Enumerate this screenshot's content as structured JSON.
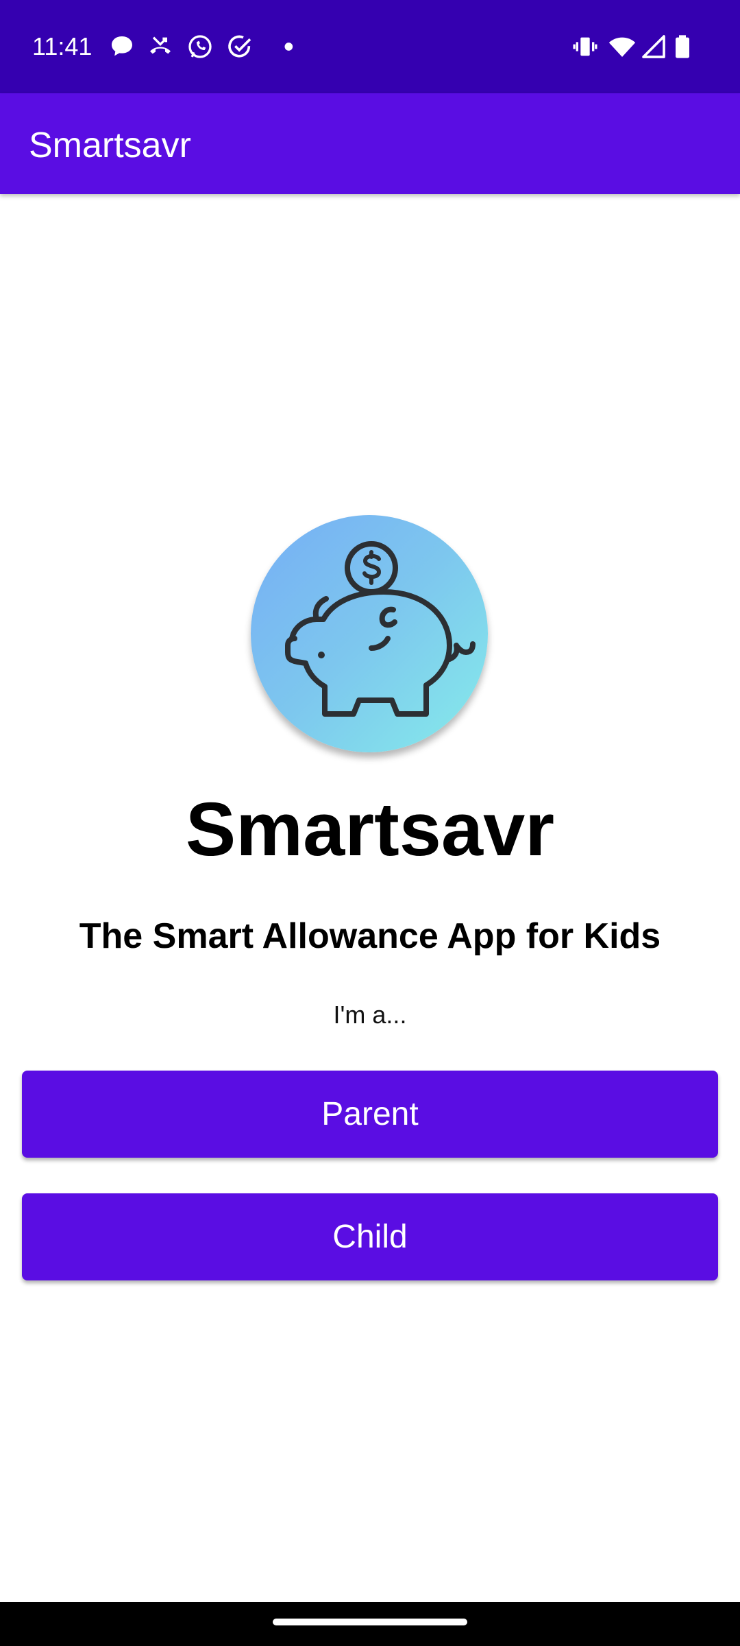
{
  "status_bar": {
    "time": "11:41",
    "icons": [
      "chat-bubble-icon",
      "missed-call-icon",
      "whatsapp-icon",
      "check-circle-icon",
      "dot-icon",
      "vibrate-icon",
      "wifi-icon",
      "cell-signal-icon",
      "battery-icon"
    ]
  },
  "app_bar": {
    "title": "Smartsavr"
  },
  "main": {
    "logo_icon": "piggy-bank-coin-icon",
    "app_name": "Smartsavr",
    "tagline": "The Smart Allowance App for Kids",
    "prompt": "I'm a...",
    "buttons": [
      {
        "label": "Parent"
      },
      {
        "label": "Child"
      }
    ]
  },
  "colors": {
    "status_bar": "#3500b0",
    "primary": "#5a0de3",
    "logo_gradient_start": "#76aef5",
    "logo_gradient_end": "#86ecea",
    "nav_bar": "#000000"
  }
}
